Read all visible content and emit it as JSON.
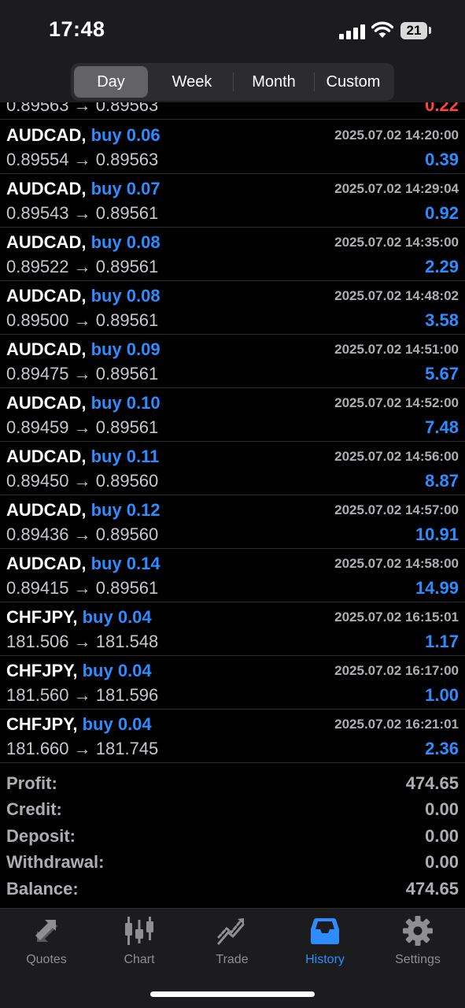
{
  "status_bar": {
    "time": "17:48",
    "battery": "21"
  },
  "segments": [
    "Day",
    "Week",
    "Month",
    "Custom"
  ],
  "partial_row": {
    "price_text": "0.89563 → 0.89563",
    "pl": "0.22"
  },
  "deals": [
    {
      "symbol": "AUDCAD,",
      "trade": "buy 0.06",
      "time": "2025.07.02 14:20:00",
      "prices": "0.89554 → 0.89563",
      "pl": "0.39"
    },
    {
      "symbol": "AUDCAD,",
      "trade": "buy 0.07",
      "time": "2025.07.02 14:29:04",
      "prices": "0.89543 → 0.89561",
      "pl": "0.92"
    },
    {
      "symbol": "AUDCAD,",
      "trade": "buy 0.08",
      "time": "2025.07.02 14:35:00",
      "prices": "0.89522 → 0.89561",
      "pl": "2.29"
    },
    {
      "symbol": "AUDCAD,",
      "trade": "buy 0.08",
      "time": "2025.07.02 14:48:02",
      "prices": "0.89500 → 0.89561",
      "pl": "3.58"
    },
    {
      "symbol": "AUDCAD,",
      "trade": "buy 0.09",
      "time": "2025.07.02 14:51:00",
      "prices": "0.89475 → 0.89561",
      "pl": "5.67"
    },
    {
      "symbol": "AUDCAD,",
      "trade": "buy 0.10",
      "time": "2025.07.02 14:52:00",
      "prices": "0.89459 → 0.89561",
      "pl": "7.48"
    },
    {
      "symbol": "AUDCAD,",
      "trade": "buy 0.11",
      "time": "2025.07.02 14:56:00",
      "prices": "0.89450 → 0.89560",
      "pl": "8.87"
    },
    {
      "symbol": "AUDCAD,",
      "trade": "buy 0.12",
      "time": "2025.07.02 14:57:00",
      "prices": "0.89436 → 0.89560",
      "pl": "10.91"
    },
    {
      "symbol": "AUDCAD,",
      "trade": "buy 0.14",
      "time": "2025.07.02 14:58:00",
      "prices": "0.89415 → 0.89561",
      "pl": "14.99"
    },
    {
      "symbol": "CHFJPY,",
      "trade": "buy 0.04",
      "time": "2025.07.02 16:15:01",
      "prices": "181.506 → 181.548",
      "pl": "1.17"
    },
    {
      "symbol": "CHFJPY,",
      "trade": "buy 0.04",
      "time": "2025.07.02 16:17:00",
      "prices": "181.560 → 181.596",
      "pl": "1.00"
    },
    {
      "symbol": "CHFJPY,",
      "trade": "buy 0.04",
      "time": "2025.07.02 16:21:01",
      "prices": "181.660 → 181.745",
      "pl": "2.36"
    }
  ],
  "summary": [
    {
      "label": "Profit:",
      "value": "474.65"
    },
    {
      "label": "Credit:",
      "value": "0.00"
    },
    {
      "label": "Deposit:",
      "value": "0.00"
    },
    {
      "label": "Withdrawal:",
      "value": "0.00"
    },
    {
      "label": "Balance:",
      "value": "474.65"
    }
  ],
  "tabs": [
    {
      "label": "Quotes",
      "icon": "quotes-icon"
    },
    {
      "label": "Chart",
      "icon": "chart-icon"
    },
    {
      "label": "Trade",
      "icon": "trade-icon"
    },
    {
      "label": "History",
      "icon": "history-icon"
    },
    {
      "label": "Settings",
      "icon": "settings-icon"
    }
  ],
  "colors": {
    "accent": "#2d8cff",
    "loss": "#ff453a",
    "background": "#000000",
    "bar": "#1c1c1e"
  }
}
